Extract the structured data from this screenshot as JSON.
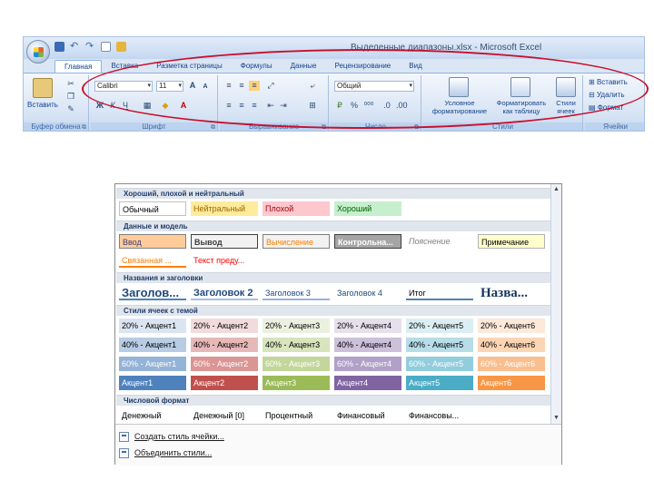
{
  "ribbon": {
    "window_title": "Выделенные диапазоны.xlsx - Microsoft Excel",
    "tabs": [
      "Главная",
      "Вставка",
      "Разметка страницы",
      "Формулы",
      "Данные",
      "Рецензирование",
      "Вид"
    ],
    "groups": {
      "clipboard": "Буфер обмена",
      "font": "Шрифт",
      "alignment": "Выравнивание",
      "number": "Число",
      "styles": "Стили",
      "cells": "Ячейки"
    },
    "paste_label": "Вставить",
    "font_name": "Calibri",
    "font_size": "11",
    "number_format": "Общий",
    "conditional_format": "Условное форматирование",
    "format_as_table": "Форматировать как таблицу",
    "cell_styles": "Стили ячеек",
    "insert_label": "Вставить",
    "delete_label": "Удалить",
    "format_label": "Формат",
    "highlight_color": "#c8102e"
  },
  "gallery": {
    "sections": [
      {
        "title": "Хороший, плохой и нейтральный",
        "rows": [
          [
            {
              "label": "Обычный",
              "bg": "#ffffff",
              "fg": "#000000",
              "border": "#c0c0c0"
            },
            {
              "label": "Нейтральный",
              "bg": "#ffeb9c",
              "fg": "#9c6500"
            },
            {
              "label": "Плохой",
              "bg": "#ffc7ce",
              "fg": "#9c0006"
            },
            {
              "label": "Хороший",
              "bg": "#c6efce",
              "fg": "#006100"
            }
          ]
        ]
      },
      {
        "title": "Данные и модель",
        "rows": [
          [
            {
              "label": "Ввод",
              "bg": "#ffcc99",
              "fg": "#3f3f76",
              "border": "#7f7f7f"
            },
            {
              "label": "Вывод",
              "bg": "#f2f2f2",
              "fg": "#3f3f3f",
              "border": "#3f3f3f",
              "bold": true
            },
            {
              "label": "Вычисление",
              "bg": "#f2f2f2",
              "fg": "#fa7d00",
              "border": "#7f7f7f"
            },
            {
              "label": "Контрольна...",
              "bg": "#a5a5a5",
              "fg": "#ffffff",
              "border": "#3f3f3f",
              "bold": true
            },
            {
              "label": "Пояснение",
              "bg": "#ffffff",
              "fg": "#7f7f7f",
              "italic": true
            },
            {
              "label": "Примечание",
              "bg": "#ffffcc",
              "fg": "#000000",
              "border": "#b2b2b2"
            }
          ],
          [
            {
              "label": "Связанная ...",
              "bg": "#ffffff",
              "fg": "#fa7d00",
              "underline": "#ff8001"
            },
            {
              "label": "Текст преду...",
              "bg": "#ffffff",
              "fg": "#ff0000"
            }
          ]
        ]
      },
      {
        "title": "Названия и заголовки",
        "rows": [
          [
            {
              "label": "Заголов...",
              "bg": "#ffffff",
              "fg": "#1f497d",
              "bold": true,
              "size": 13,
              "underline": "#4f81bd"
            },
            {
              "label": "Заголовок 2",
              "bg": "#ffffff",
              "fg": "#1f497d",
              "bold": true,
              "size": 11,
              "underline": "#a7bfde"
            },
            {
              "label": "Заголовок 3",
              "bg": "#ffffff",
              "fg": "#1f497d",
              "size": 9,
              "underline": "#95b3d7"
            },
            {
              "label": "Заголовок 4",
              "bg": "#ffffff",
              "fg": "#1f497d",
              "size": 9
            },
            {
              "label": "Итог",
              "bg": "#ffffff",
              "fg": "#000000",
              "size": 9,
              "underline": "#4f81bd"
            },
            {
              "label": "Назва...",
              "bg": "#ffffff",
              "fg": "#17365d",
              "bold": true,
              "size": 15,
              "serif": true
            }
          ]
        ]
      },
      {
        "title": "Стили ячеек с темой",
        "rows": [
          [
            {
              "label": "20% - Акцент1",
              "bg": "#dbe5f1",
              "fg": "#000000"
            },
            {
              "label": "20% - Акцент2",
              "bg": "#f2dcdb",
              "fg": "#000000"
            },
            {
              "label": "20% - Акцент3",
              "bg": "#ebf1de",
              "fg": "#000000"
            },
            {
              "label": "20% - Акцент4",
              "bg": "#e5e0ec",
              "fg": "#000000"
            },
            {
              "label": "20% - Акцент5",
              "bg": "#dbeef3",
              "fg": "#000000"
            },
            {
              "label": "20% - Акцент6",
              "bg": "#fde9d9",
              "fg": "#000000"
            }
          ],
          [
            {
              "label": "40% - Акцент1",
              "bg": "#b8cce4",
              "fg": "#000000"
            },
            {
              "label": "40% - Акцент2",
              "bg": "#e6b9b8",
              "fg": "#000000"
            },
            {
              "label": "40% - Акцент3",
              "bg": "#d7e4bc",
              "fg": "#000000"
            },
            {
              "label": "40% - Акцент4",
              "bg": "#ccc0da",
              "fg": "#000000"
            },
            {
              "label": "40% - Акцент5",
              "bg": "#b7dde8",
              "fg": "#000000"
            },
            {
              "label": "40% - Акцент6",
              "bg": "#fcd5b4",
              "fg": "#000000"
            }
          ],
          [
            {
              "label": "60% - Акцент1",
              "bg": "#95b3d7",
              "fg": "#ffffff"
            },
            {
              "label": "60% - Акцент2",
              "bg": "#da9694",
              "fg": "#ffffff"
            },
            {
              "label": "60% - Акцент3",
              "bg": "#c3d69b",
              "fg": "#ffffff"
            },
            {
              "label": "60% - Акцент4",
              "bg": "#b1a0c7",
              "fg": "#ffffff"
            },
            {
              "label": "60% - Акцент5",
              "bg": "#92cddc",
              "fg": "#ffffff"
            },
            {
              "label": "60% - Акцент6",
              "bg": "#fabf8f",
              "fg": "#ffffff"
            }
          ],
          [
            {
              "label": "Акцент1",
              "bg": "#4f81bd",
              "fg": "#ffffff"
            },
            {
              "label": "Акцент2",
              "bg": "#c0504d",
              "fg": "#ffffff"
            },
            {
              "label": "Акцент3",
              "bg": "#9bbb59",
              "fg": "#ffffff"
            },
            {
              "label": "Акцент4",
              "bg": "#8064a2",
              "fg": "#ffffff"
            },
            {
              "label": "Акцент5",
              "bg": "#4bacc6",
              "fg": "#ffffff"
            },
            {
              "label": "Акцент6",
              "bg": "#f79646",
              "fg": "#ffffff"
            }
          ]
        ]
      },
      {
        "title": "Числовой формат",
        "rows": [
          [
            {
              "label": "Денежный",
              "bg": "#ffffff",
              "fg": "#000000"
            },
            {
              "label": "Денежный [0]",
              "bg": "#ffffff",
              "fg": "#000000"
            },
            {
              "label": "Процентный",
              "bg": "#ffffff",
              "fg": "#000000"
            },
            {
              "label": "Финансовый",
              "bg": "#ffffff",
              "fg": "#000000"
            },
            {
              "label": "Финансовы...",
              "bg": "#ffffff",
              "fg": "#000000"
            }
          ]
        ]
      }
    ],
    "footer": [
      "Создать стиль ячейки...",
      "Объединить стили..."
    ]
  }
}
